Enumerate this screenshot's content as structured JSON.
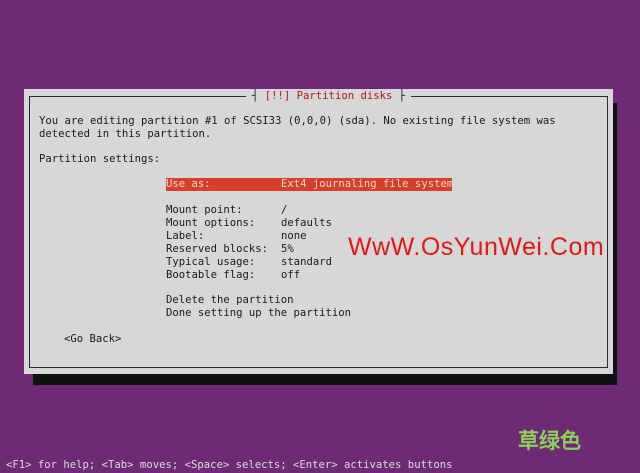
{
  "dialog": {
    "title": "[!!] Partition disks",
    "message_line1": "You are editing partition #1 of SCSI33 (0,0,0) (sda). No existing file system was",
    "message_line2": "detected in this partition.",
    "settings_heading": "Partition settings:",
    "use_as_label": "Use as:",
    "use_as_value": "Ext4 journaling file system",
    "settings": [
      {
        "label": "Mount point:",
        "value": "/"
      },
      {
        "label": "Mount options:",
        "value": "defaults"
      },
      {
        "label": "Label:",
        "value": "none"
      },
      {
        "label": "Reserved blocks:",
        "value": "5%"
      },
      {
        "label": "Typical usage:",
        "value": "standard"
      },
      {
        "label": "Bootable flag:",
        "value": "off"
      }
    ],
    "delete_action": "Delete the partition",
    "done_action": "Done setting up the partition",
    "go_back": "<Go Back>"
  },
  "watermark": "WwW.OsYunWei.Com",
  "cn_watermark": "草绿色",
  "status_bar": "<F1> for help; <Tab> moves; <Space> selects; <Enter> activates buttons",
  "colors": {
    "background": "#6e2a74",
    "dialog": "#d7d7d7",
    "selection": "#d6402a",
    "title_text": "#b01a12",
    "watermark": "#e01818",
    "cn_watermark": "#8ed15a"
  }
}
